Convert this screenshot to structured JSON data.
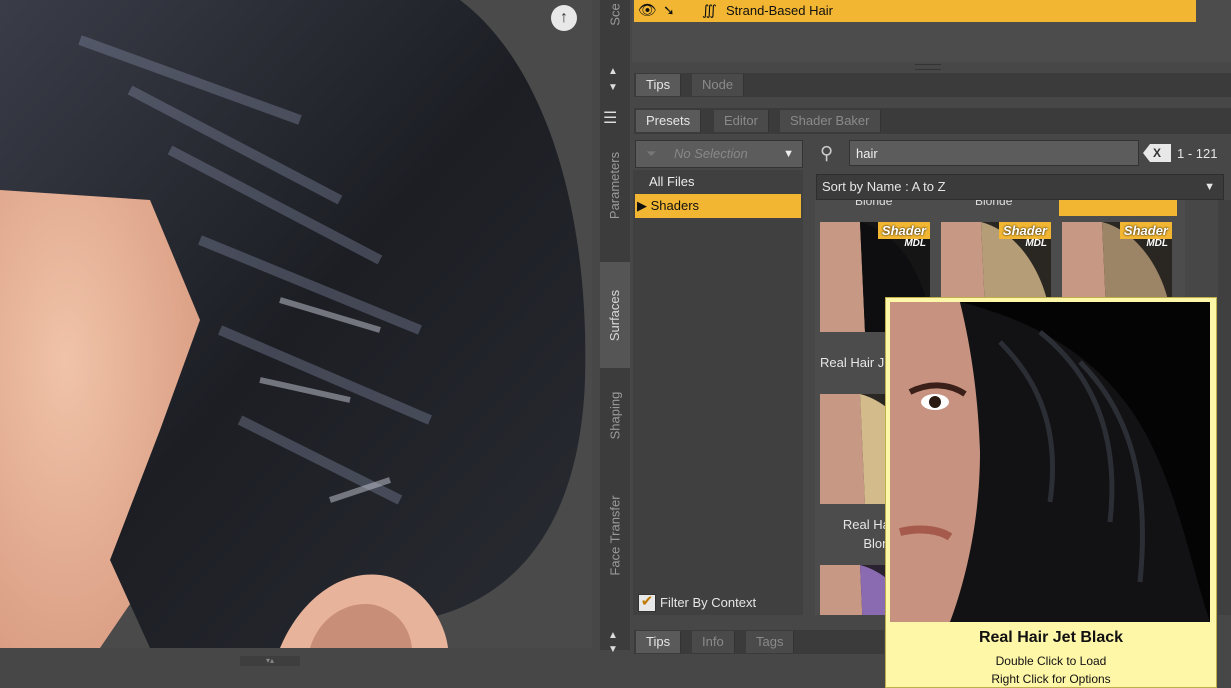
{
  "scene": {
    "tab_label": "Sce",
    "row_label": "Strand-Based Hair",
    "icons": [
      "eye-icon",
      "pointer-icon",
      "hair-strand-icon"
    ]
  },
  "vertical_tabs": [
    "Parameters",
    "Surfaces",
    "Shaping",
    "Face Transfer"
  ],
  "top_tabs": [
    "Tips",
    "Node"
  ],
  "library_tabs": [
    "Presets",
    "Editor",
    "Shader Baker"
  ],
  "filter": {
    "placeholder": "No Selection",
    "context_label": "Filter By Context"
  },
  "tree": [
    {
      "label": "All Files"
    },
    {
      "label": "▶ Shaders"
    }
  ],
  "search": {
    "value": "hair",
    "clear_label": "X",
    "count": "1 - 121"
  },
  "sort": {
    "label": "Sort by Name : A to Z"
  },
  "grid": {
    "cut_top_labels": [
      "Blonde",
      "Blonde"
    ],
    "badge": "Shader",
    "badge_sub": "MDL",
    "items": [
      {
        "label": "Real Hair J"
      },
      {
        "label": "Real Hair Blonde"
      }
    ],
    "label_lines": [
      "Real Hair",
      "Blond"
    ]
  },
  "bottom_tabs": [
    "Tips",
    "Info",
    "Tags"
  ],
  "tooltip": {
    "title": "Real Hair Jet Black",
    "hint_load": "Double Click to Load",
    "hint_options": "Right Click for Options"
  },
  "colors": {
    "accent": "#f2b632",
    "panel": "#474747",
    "tooltip_bg": "#fff7a8"
  }
}
